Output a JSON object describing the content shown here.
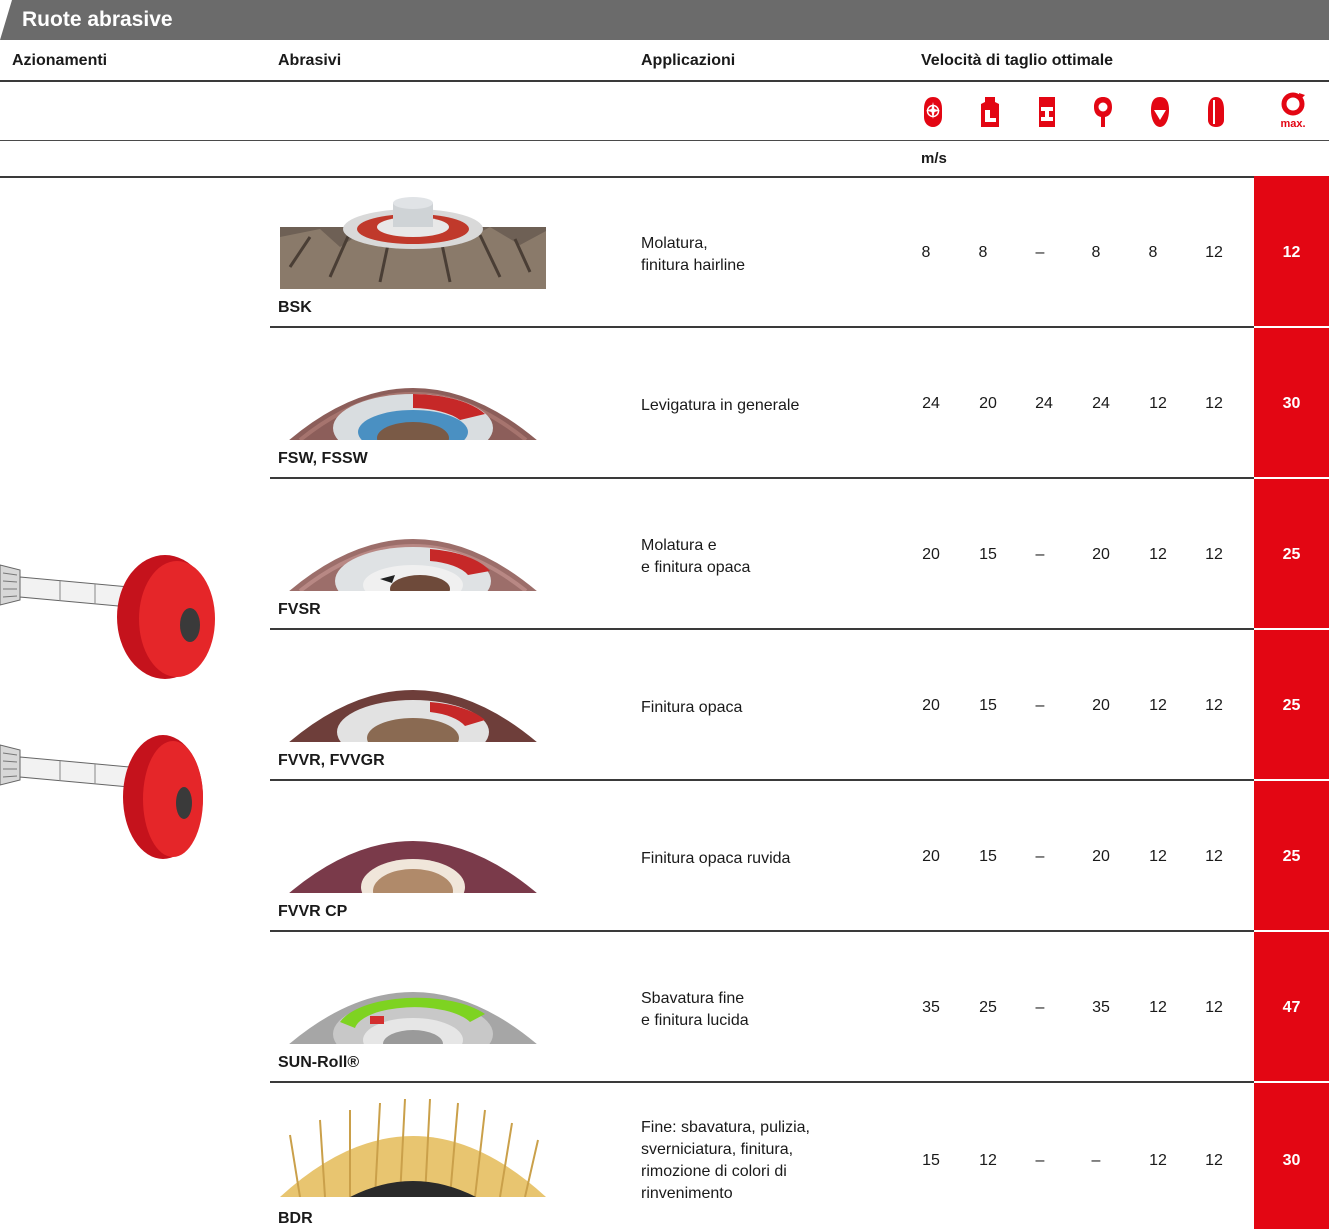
{
  "title": "Ruote abrasive",
  "columns": {
    "drives": "Azionamenti",
    "abrasives": "Abrasivi",
    "applications": "Applicazioni",
    "speed": "Velocità di taglio ottimale"
  },
  "unit": "m/s",
  "max_label": "max.",
  "speed_icons": [
    "round-tube-icon",
    "profile-icon",
    "i-beam-icon",
    "pipe-weld-icon",
    "sheet-edge-icon",
    "flat-sheet-icon",
    "max-rpm-icon"
  ],
  "colors": {
    "title_bar": "#6b6b6b",
    "accent_red": "#e30613"
  },
  "rows": [
    {
      "name": "BSK",
      "appl": [
        "Molatura,",
        "finitura hairline"
      ],
      "speeds": [
        "8",
        "8",
        "–",
        "8",
        "8",
        "12"
      ],
      "max": "12",
      "image": "brush-wheel"
    },
    {
      "name": "FSW, FSSW",
      "appl": [
        "Levigatura in generale"
      ],
      "speeds": [
        "24",
        "20",
        "24",
        "24",
        "12",
        "12"
      ],
      "max": "30",
      "image": "flap-wheel"
    },
    {
      "name": "FVSR",
      "appl": [
        "Molatura e",
        "e finitura opaca"
      ],
      "speeds": [
        "20",
        "15",
        "–",
        "20",
        "12",
        "12"
      ],
      "max": "25",
      "image": "flap-fleece-wheel"
    },
    {
      "name": "FVVR, FVVGR",
      "appl": [
        "Finitura opaca"
      ],
      "speeds": [
        "20",
        "15",
        "–",
        "20",
        "12",
        "12"
      ],
      "max": "25",
      "image": "fleece-wheel"
    },
    {
      "name": "FVVR CP",
      "appl": [
        "Finitura opaca ruvida"
      ],
      "speeds": [
        "20",
        "15",
        "–",
        "20",
        "12",
        "12"
      ],
      "max": "25",
      "image": "compact-fleece-wheel"
    },
    {
      "name": "SUN-Roll®",
      "appl": [
        "Sbavatura fine",
        "e finitura lucida"
      ],
      "speeds": [
        "35",
        "25",
        "–",
        "35",
        "12",
        "12"
      ],
      "max": "47",
      "image": "sun-roll-wheel"
    },
    {
      "name": "BDR",
      "appl": [
        "Fine: sbavatura, pulizia,",
        "sverniciatura, finitura,",
        "rimozione di colori di",
        "rinvenimento"
      ],
      "speeds": [
        "15",
        "12",
        "–",
        "–",
        "12",
        "12"
      ],
      "max": "30",
      "image": "bristle-disc"
    }
  ]
}
